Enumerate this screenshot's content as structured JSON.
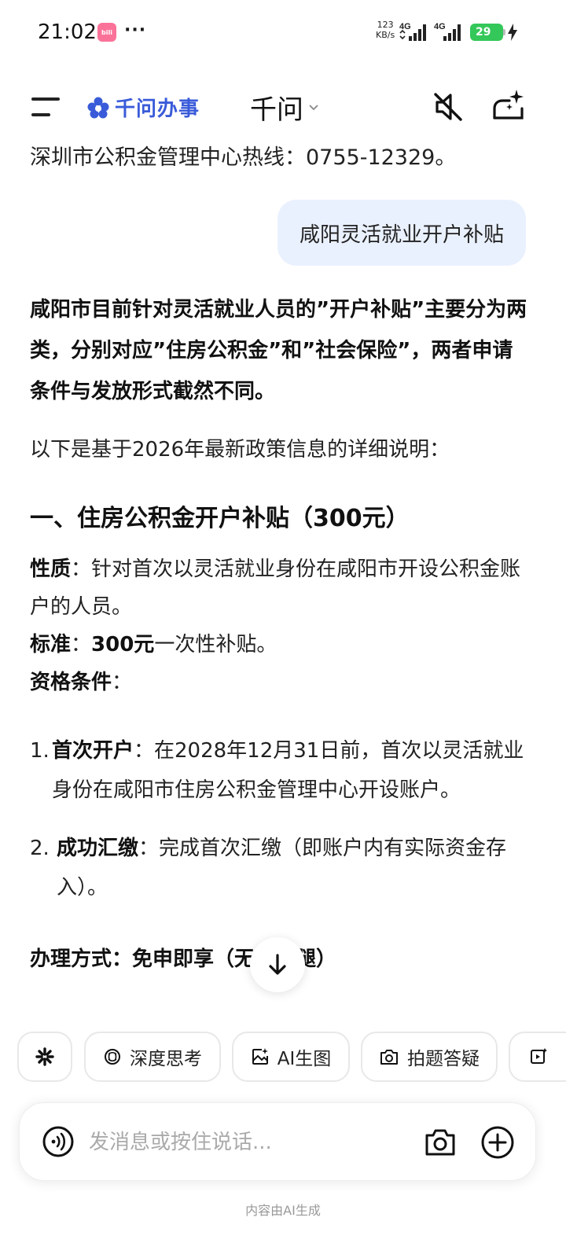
{
  "status_bar": {
    "time": "21:02",
    "notif_app": "bilibili",
    "more": "···",
    "speed_value": "123",
    "speed_unit": "KB/s",
    "net1": "4G",
    "net2": "4G",
    "battery": "29"
  },
  "header": {
    "brand": "千问办事",
    "title": "千问"
  },
  "chat": {
    "cut_line": "深圳市公积金管理中心热线：0755-12329。",
    "user_message": "咸阳灵活就业开户补贴",
    "ai": {
      "intro": "咸阳市目前针对灵活就业人员的”开户补贴”主要分为两类，分别对应”住房公积金”和”社会保险”，两者申请条件与发放形式截然不同。",
      "note": "以下是基于2026年最新政策信息的详细说明：",
      "section_title": "一、住房公积金开户补贴（300元）",
      "nature_label": "性质",
      "nature_text": "：针对首次以灵活就业身份在咸阳市开设公积金账户的人员。",
      "standard_label": "标准",
      "standard_value": "300元",
      "standard_text": "一次性补贴。",
      "qual_label": "资格条件",
      "qual_colon": "：",
      "items": [
        {
          "num": "1.",
          "label": "首次开户",
          "text": "：在2028年12月31日前，首次以灵活就业身份在咸阳市住房公积金管理中心开设账户。"
        },
        {
          "num": "2.",
          "label": "成功汇缴",
          "text": "：完成首次汇缴（即账户内有实际资金存入）。"
        }
      ],
      "method_label": "办理方式：",
      "method_value": "免申即享（无需跑腿）"
    }
  },
  "chips": [
    {
      "icon": "spark-icon",
      "label": ""
    },
    {
      "icon": "brain-icon",
      "label": "深度思考"
    },
    {
      "icon": "image-spark-icon",
      "label": "AI生图"
    },
    {
      "icon": "camera-question-icon",
      "label": "拍题答疑"
    },
    {
      "icon": "video-icon",
      "label": ""
    }
  ],
  "input": {
    "placeholder": "发消息或按住说话..."
  },
  "footer": "内容由AI生成",
  "colors": {
    "brand": "#3a5bd9",
    "user_bubble": "#eaf1fe",
    "battery": "#34c759"
  }
}
